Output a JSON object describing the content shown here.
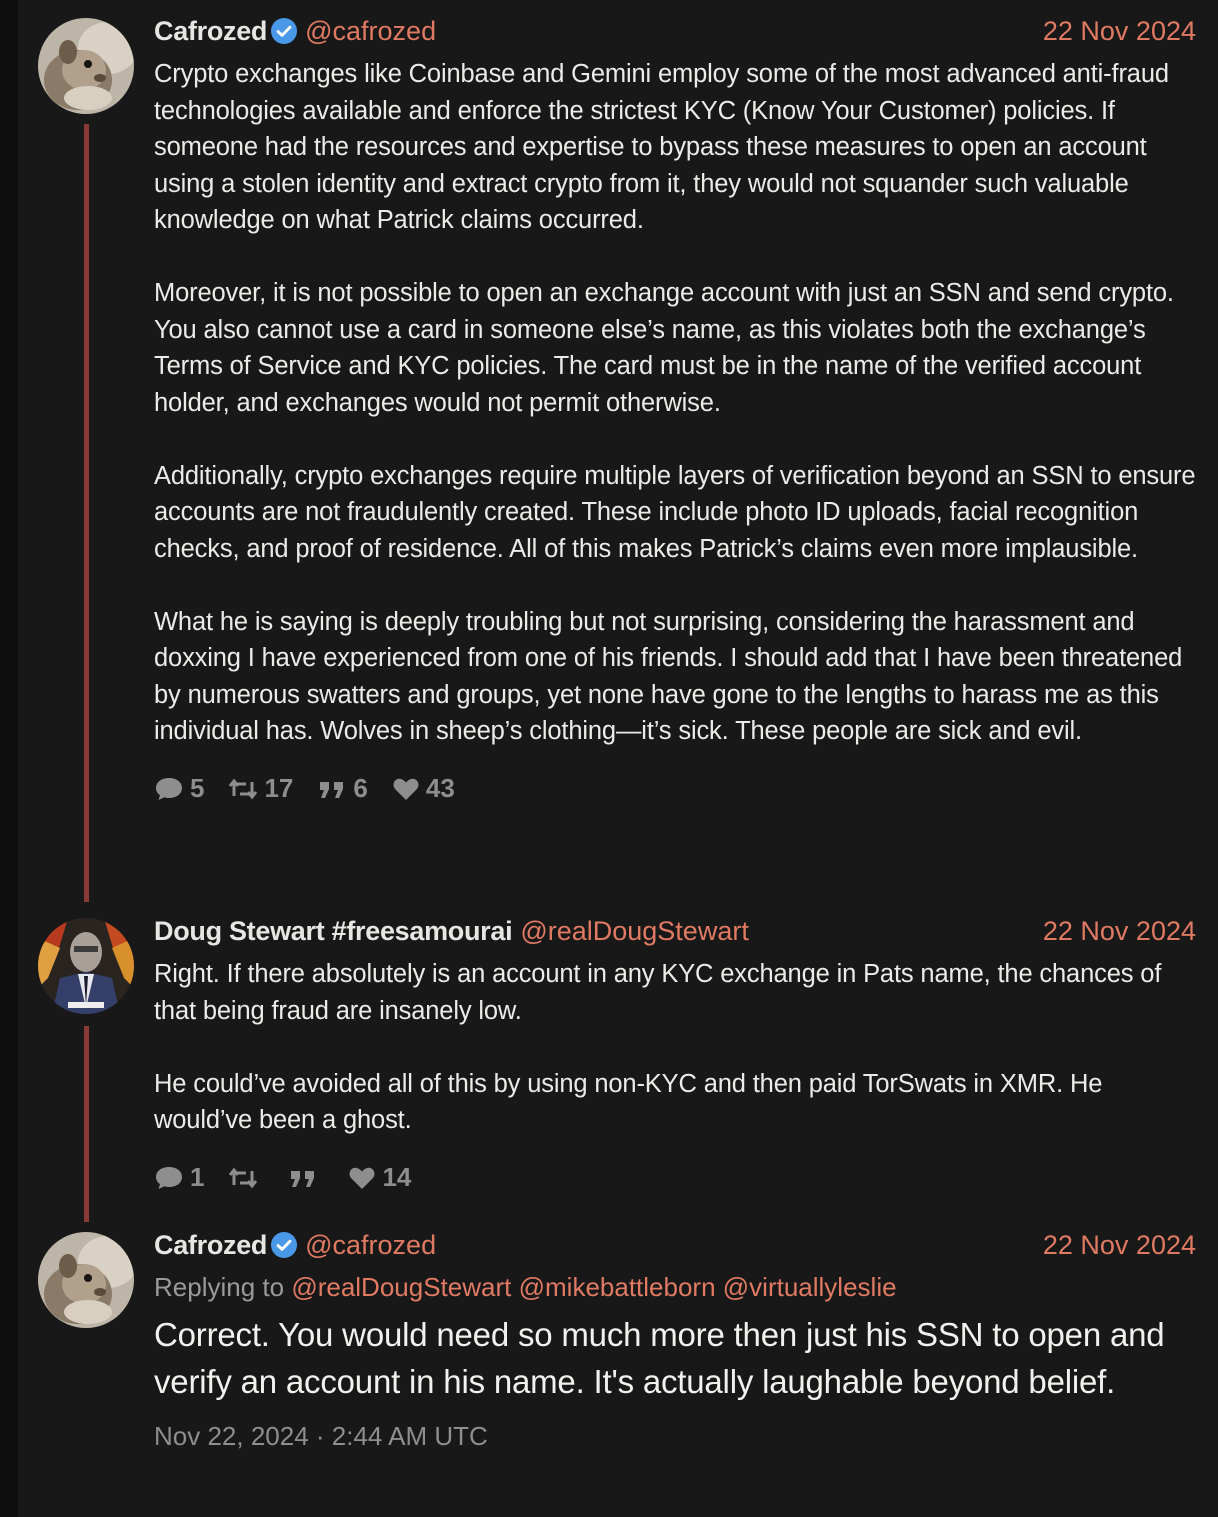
{
  "tweets": [
    {
      "fullname": "Cafrozed",
      "verified": true,
      "handle": "@cafrozed",
      "date": "22 Nov 2024",
      "paragraphs": [
        "Crypto exchanges like Coinbase and Gemini employ some of the most advanced anti-fraud technologies available and enforce the strictest KYC (Know Your Customer) policies. If someone had the resources and expertise to bypass these measures to open an account using a stolen identity and extract crypto from it, they would not squander such valuable knowledge on what Patrick claims occurred.",
        "Moreover, it is not possible to open an exchange account with just an SSN and send crypto. You also cannot use a card in someone else’s name, as this violates both the exchange’s Terms of Service and KYC policies. The card must be in the name of the verified account holder, and exchanges would not permit otherwise.",
        "Additionally, crypto exchanges require multiple layers of verification beyond an SSN to ensure accounts are not fraudulently created. These include photo ID uploads, facial recognition checks, and proof of residence. All of this makes Patrick’s claims even more implausible.",
        "What he is saying is deeply troubling but not surprising, considering the harassment and doxxing I have experienced from one of his friends. I should add that I have been threatened by numerous swatters and groups, yet none have gone to the lengths to harass me as this individual has. Wolves in sheep’s clothing—it’s sick. These people are sick and evil."
      ],
      "stats": {
        "replies": "5",
        "retweets": "17",
        "quotes": "6",
        "likes": "43"
      }
    },
    {
      "fullname": "Doug Stewart #freesamourai",
      "verified": false,
      "handle": "@realDougStewart",
      "date": "22 Nov 2024",
      "paragraphs": [
        "Right. If there absolutely is an account in any KYC exchange in Pats name, the chances of that being fraud are insanely low.",
        "He could’ve avoided all of this by using non-KYC and then paid TorSwats in XMR. He would’ve been a ghost."
      ],
      "stats": {
        "replies": "1",
        "retweets": "",
        "quotes": "",
        "likes": "14"
      }
    },
    {
      "fullname": "Cafrozed",
      "verified": true,
      "handle": "@cafrozed",
      "date": "22 Nov 2024",
      "replying_label": "Replying to",
      "replying_to": [
        "@realDougStewart",
        "@mikebattleborn",
        "@virtuallyleslie"
      ],
      "text": "Correct. You would need so much more then just his SSN to open and verify an account in his name. It's actually laughable beyond belief.",
      "timestamp": "Nov 22, 2024 · 2:44 AM UTC"
    }
  ],
  "icons": {
    "reply": "speech-bubble-icon",
    "retweet": "retweet-icon",
    "quote": "quote-icon",
    "like": "heart-icon",
    "verified": "verified-badge-icon"
  },
  "colors": {
    "background": "#181818",
    "accent": "#e07a62",
    "thread_line": "#8a3a36",
    "verified": "#4a99e9",
    "muted": "#8e8e8e"
  }
}
